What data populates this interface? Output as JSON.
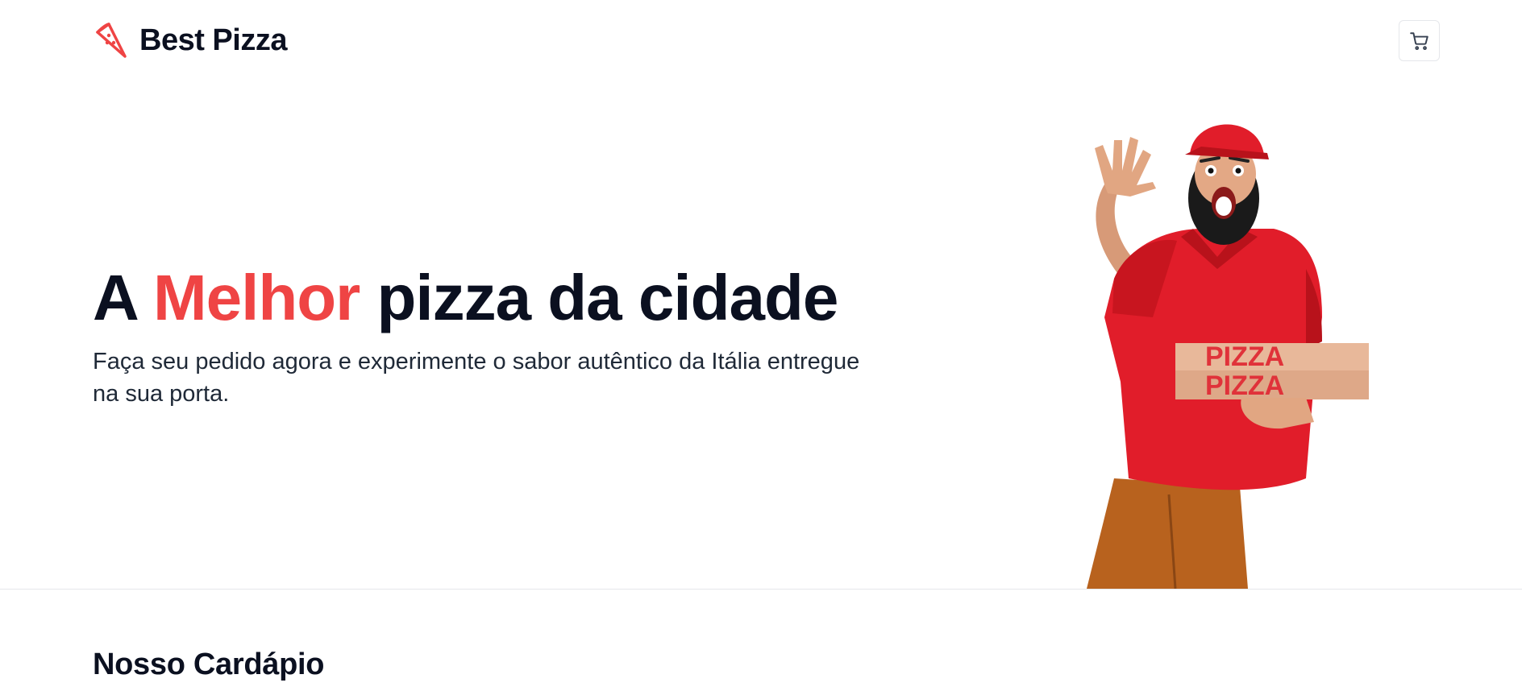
{
  "header": {
    "brand_name": "Best Pizza",
    "brand_icon": "pizza-slice-icon",
    "cart_icon": "shopping-cart-icon"
  },
  "hero": {
    "title_part1": "A ",
    "title_accent": "Melhor",
    "title_part2": " pizza da cidade",
    "subtitle": "Faça seu pedido agora e experimente o sabor autêntico da Itália entregue na sua porta.",
    "image_box_text": "PIZZA"
  },
  "menu": {
    "title": "Nosso Cardápio"
  },
  "colors": {
    "accent": "#ef4444",
    "text": "#0b1020",
    "shirt": "#e11d2a",
    "border": "#e5e7eb"
  }
}
